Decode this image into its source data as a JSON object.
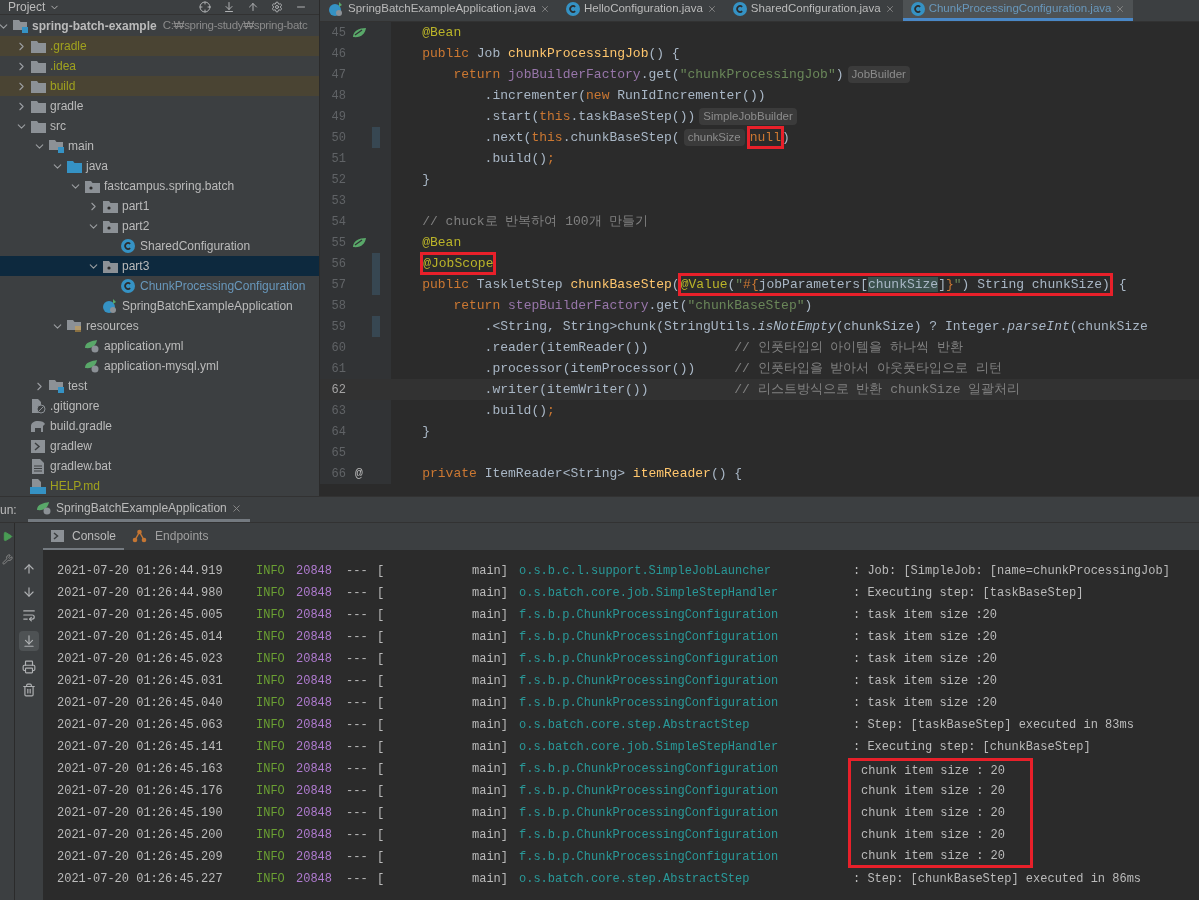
{
  "project_panel": {
    "title": "Project",
    "tree": [
      {
        "name": "spring-batch-example",
        "path": "C:₩spring-study₩spring-batc",
        "kind": "module",
        "expanded": true,
        "selected": false,
        "children": [
          {
            "name": ".gradle",
            "kind": "folder",
            "expanded": false,
            "selected": false,
            "excluded": true,
            "ignored": true
          },
          {
            "name": ".idea",
            "kind": "folder",
            "expanded": false,
            "selected": false,
            "excluded": false,
            "ignored": true
          },
          {
            "name": "build",
            "kind": "folder",
            "expanded": false,
            "selected": false,
            "excluded": true,
            "ignored": true
          },
          {
            "name": "gradle",
            "kind": "folder",
            "expanded": false,
            "selected": false
          },
          {
            "name": "src",
            "kind": "folder",
            "expanded": true,
            "selected": false,
            "children": [
              {
                "name": "main",
                "kind": "module",
                "expanded": true,
                "selected": false,
                "children": [
                  {
                    "name": "java",
                    "kind": "source",
                    "expanded": true,
                    "selected": false,
                    "children": [
                      {
                        "name": "fastcampus.spring.batch",
                        "kind": "package",
                        "expanded": true,
                        "selected": false,
                        "children": [
                          {
                            "name": "part1",
                            "kind": "package",
                            "expanded": false,
                            "selected": false
                          },
                          {
                            "name": "part2",
                            "kind": "package",
                            "expanded": true,
                            "selected": false,
                            "children": [
                              {
                                "name": "SharedConfiguration",
                                "kind": "class",
                                "selected": false
                              }
                            ]
                          },
                          {
                            "name": "part3",
                            "kind": "package",
                            "expanded": true,
                            "selected": true,
                            "children": [
                              {
                                "name": "ChunkProcessingConfiguration",
                                "kind": "class",
                                "selected": false,
                                "modified": true
                              }
                            ]
                          },
                          {
                            "name": "SpringBatchExampleApplication",
                            "kind": "spring",
                            "selected": false
                          }
                        ]
                      }
                    ]
                  },
                  {
                    "name": "resources",
                    "kind": "resources",
                    "expanded": true,
                    "selected": false,
                    "children": [
                      {
                        "name": "application.yml",
                        "kind": "yml",
                        "selected": false
                      },
                      {
                        "name": "application-mysql.yml",
                        "kind": "yml",
                        "selected": false
                      }
                    ]
                  }
                ]
              },
              {
                "name": "test",
                "kind": "module",
                "expanded": false,
                "selected": false
              }
            ]
          },
          {
            "name": ".gitignore",
            "kind": "gitignore",
            "selected": false
          },
          {
            "name": "build.gradle",
            "kind": "gradle",
            "selected": false
          },
          {
            "name": "gradlew",
            "kind": "shell",
            "selected": false
          },
          {
            "name": "gradlew.bat",
            "kind": "text",
            "selected": false
          },
          {
            "name": "HELP.md",
            "kind": "md",
            "selected": false,
            "ignored": true
          }
        ]
      }
    ]
  },
  "editor": {
    "tabs": [
      {
        "label": "SpringBatchExampleApplication.java",
        "kind": "spring",
        "selected": false
      },
      {
        "label": "HelloConfiguration.java",
        "kind": "class",
        "selected": false
      },
      {
        "label": "SharedConfiguration.java",
        "kind": "class",
        "selected": false
      },
      {
        "label": "ChunkProcessingConfiguration.java",
        "kind": "class",
        "selected": true
      }
    ],
    "lines": [
      {
        "number": "45",
        "kind": "bean",
        "current": false,
        "segments": [
          {
            "text": "    @Bean",
            "kind": "annotation"
          }
        ]
      },
      {
        "number": "46",
        "kind": "code",
        "current": false,
        "segments": [
          {
            "text": "    public",
            "kind": "keyword"
          },
          {
            "text": " Job ",
            "kind": "plain"
          },
          {
            "text": "chunkProcessingJob",
            "kind": "method"
          },
          {
            "text": "() {",
            "kind": "plain"
          }
        ]
      },
      {
        "number": "47",
        "kind": "code",
        "current": false,
        "segments": [
          {
            "text": "        return ",
            "kind": "keyword"
          },
          {
            "text": "jobBuilderFactory",
            "kind": "field"
          },
          {
            "text": ".get(",
            "kind": "plain"
          },
          {
            "text": "\"chunkProcessingJob\"",
            "kind": "string"
          },
          {
            "text": ")",
            "kind": "plain"
          },
          {
            "text": "JobBuilder",
            "kind": "hint"
          }
        ]
      },
      {
        "number": "48",
        "kind": "code",
        "current": false,
        "segments": [
          {
            "text": "            .incrementer(",
            "kind": "plain"
          },
          {
            "text": "new",
            "kind": "keyword"
          },
          {
            "text": " RunIdIncrementer())",
            "kind": "plain"
          }
        ]
      },
      {
        "number": "49",
        "kind": "code",
        "current": false,
        "segments": [
          {
            "text": "            .start(",
            "kind": "plain"
          },
          {
            "text": "this",
            "kind": "keyword"
          },
          {
            "text": ".taskBaseStep())",
            "kind": "plain"
          },
          {
            "text": "SimpleJobBuilder",
            "kind": "hint"
          }
        ]
      },
      {
        "number": "50",
        "kind": "code",
        "current": false,
        "changed": true,
        "segments": [
          {
            "text": "            .next(",
            "kind": "plain"
          },
          {
            "text": "this",
            "kind": "keyword"
          },
          {
            "text": ".chunkBaseStep(",
            "kind": "plain"
          },
          {
            "text": "chunkSize",
            "kind": "hint"
          },
          {
            "kind": "box",
            "segments": [
              {
                "text": "null",
                "kind": "keyword"
              }
            ]
          },
          {
            "text": ")",
            "kind": "plain"
          }
        ]
      },
      {
        "number": "51",
        "kind": "code",
        "current": false,
        "segments": [
          {
            "text": "            .build()",
            "kind": "plain"
          },
          {
            "text": ";",
            "kind": "keyword"
          }
        ]
      },
      {
        "number": "52",
        "kind": "code",
        "current": false,
        "segments": [
          {
            "text": "    }",
            "kind": "plain"
          }
        ]
      },
      {
        "number": "53",
        "kind": "code",
        "current": false
      },
      {
        "number": "54",
        "kind": "code",
        "current": false,
        "segments": [
          {
            "text": "    // chuck로 반복하여 100개 만들기",
            "kind": "comment"
          }
        ]
      },
      {
        "number": "55",
        "kind": "bean",
        "current": false,
        "segments": [
          {
            "text": "    @Bean",
            "kind": "annotation"
          }
        ]
      },
      {
        "number": "56",
        "kind": "code",
        "current": false,
        "changed": true,
        "segments": [
          {
            "kind": "box",
            "segments": [
              {
                "text": "    @JobScope",
                "kind": "annotation"
              }
            ]
          }
        ]
      },
      {
        "number": "57",
        "kind": "code",
        "current": false,
        "changed": true,
        "segments": [
          {
            "text": "    public",
            "kind": "keyword"
          },
          {
            "text": " TaskletStep ",
            "kind": "plain"
          },
          {
            "text": "chunkBaseStep",
            "kind": "method"
          },
          {
            "text": "(",
            "kind": "plain"
          },
          {
            "kind": "box",
            "segments": [
              {
                "text": "@Value",
                "kind": "annotation"
              },
              {
                "text": "(",
                "kind": "plain"
              },
              {
                "text": "\"",
                "kind": "string"
              },
              {
                "text": "#{",
                "kind": "keyword"
              },
              {
                "text": "jobParameters[",
                "kind": "plain"
              },
              {
                "text": "chunkSize",
                "kind": "match"
              },
              {
                "text": "]",
                "kind": "plain"
              },
              {
                "text": "}",
                "kind": "keyword"
              },
              {
                "text": "\"",
                "kind": "string"
              },
              {
                "text": ") String chunkSize)",
                "kind": "plain"
              }
            ]
          },
          {
            "text": " {",
            "kind": "plain"
          }
        ]
      },
      {
        "number": "58",
        "kind": "code",
        "current": false,
        "segments": [
          {
            "text": "        return ",
            "kind": "keyword"
          },
          {
            "text": "stepBuilderFactory",
            "kind": "field"
          },
          {
            "text": ".get(",
            "kind": "plain"
          },
          {
            "text": "\"chunkBaseStep\"",
            "kind": "string"
          },
          {
            "text": ")",
            "kind": "plain"
          }
        ]
      },
      {
        "number": "59",
        "kind": "code",
        "current": false,
        "changed": true,
        "segments": [
          {
            "text": "            .<String, String>chunk(StringUtils.",
            "kind": "plain"
          },
          {
            "text": "isNotEmpty",
            "kind": "static"
          },
          {
            "text": "(chunkSize) ? Integer.",
            "kind": "plain"
          },
          {
            "text": "parseInt",
            "kind": "static"
          },
          {
            "text": "(chunkSize",
            "kind": "plain"
          }
        ]
      },
      {
        "number": "60",
        "kind": "code",
        "current": false,
        "segments": [
          {
            "text": "            .reader(itemReader())",
            "kind": "plain"
          },
          {
            "text": "           // 인풋타입의 아이템을 하나씩 반환",
            "kind": "comment"
          }
        ]
      },
      {
        "number": "61",
        "kind": "code",
        "current": false,
        "segments": [
          {
            "text": "            .processor(itemProcessor())",
            "kind": "plain"
          },
          {
            "text": "     // 인풋타입을 받아서 아웃풋타입으로 리턴",
            "kind": "comment"
          }
        ]
      },
      {
        "number": "62",
        "kind": "code",
        "current": true,
        "segments": [
          {
            "text": "            .writer(itemWriter())",
            "kind": "plain"
          },
          {
            "text": "           // 리스트방식으로 반환 chunkSize 일괄처리",
            "kind": "comment"
          }
        ]
      },
      {
        "number": "63",
        "kind": "code",
        "current": false,
        "segments": [
          {
            "text": "            .build()",
            "kind": "plain"
          },
          {
            "text": ";",
            "kind": "keyword"
          }
        ]
      },
      {
        "number": "64",
        "kind": "code",
        "current": false,
        "segments": [
          {
            "text": "    }",
            "kind": "plain"
          }
        ]
      },
      {
        "number": "65",
        "kind": "code",
        "current": false
      },
      {
        "number": "66",
        "kind": "code",
        "current": false,
        "gutter_text": "@",
        "segments": [
          {
            "text": "    private",
            "kind": "keyword"
          },
          {
            "text": " ItemReader<String> ",
            "kind": "plain"
          },
          {
            "text": "itemReader",
            "kind": "method"
          },
          {
            "text": "() {",
            "kind": "plain"
          }
        ]
      }
    ]
  },
  "run_panel": {
    "label": "un:",
    "tab": "SpringBatchExampleApplication",
    "subtabs": [
      {
        "label": "Console",
        "kind": "console",
        "selected": true
      },
      {
        "label": "Endpoints",
        "kind": "endpoints",
        "selected": false
      }
    ],
    "log": [
      {
        "time": "2021-07-20 01:26:44.919",
        "level": "INFO",
        "pid": "20848",
        "sep": "---",
        "bracket": "[",
        "thread": "main]",
        "logger": "o.s.b.c.l.support.SimpleJobLauncher",
        "message": ": Job: [SimpleJob: [name=chunkProcessingJob]",
        "boxed": false
      },
      {
        "time": "2021-07-20 01:26:44.980",
        "level": "INFO",
        "pid": "20848",
        "sep": "---",
        "bracket": "[",
        "thread": "main]",
        "logger": "o.s.batch.core.job.SimpleStepHandler",
        "message": ": Executing step: [taskBaseStep]",
        "boxed": false
      },
      {
        "time": "2021-07-20 01:26:45.005",
        "level": "INFO",
        "pid": "20848",
        "sep": "---",
        "bracket": "[",
        "thread": "main]",
        "logger": "f.s.b.p.ChunkProcessingConfiguration",
        "message": ": task item size :20",
        "boxed": false
      },
      {
        "time": "2021-07-20 01:26:45.014",
        "level": "INFO",
        "pid": "20848",
        "sep": "---",
        "bracket": "[",
        "thread": "main]",
        "logger": "f.s.b.p.ChunkProcessingConfiguration",
        "message": ": task item size :20",
        "boxed": false
      },
      {
        "time": "2021-07-20 01:26:45.023",
        "level": "INFO",
        "pid": "20848",
        "sep": "---",
        "bracket": "[",
        "thread": "main]",
        "logger": "f.s.b.p.ChunkProcessingConfiguration",
        "message": ": task item size :20",
        "boxed": false
      },
      {
        "time": "2021-07-20 01:26:45.031",
        "level": "INFO",
        "pid": "20848",
        "sep": "---",
        "bracket": "[",
        "thread": "main]",
        "logger": "f.s.b.p.ChunkProcessingConfiguration",
        "message": ": task item size :20",
        "boxed": false
      },
      {
        "time": "2021-07-20 01:26:45.040",
        "level": "INFO",
        "pid": "20848",
        "sep": "---",
        "bracket": "[",
        "thread": "main]",
        "logger": "f.s.b.p.ChunkProcessingConfiguration",
        "message": ": task item size :20",
        "boxed": false
      },
      {
        "time": "2021-07-20 01:26:45.063",
        "level": "INFO",
        "pid": "20848",
        "sep": "---",
        "bracket": "[",
        "thread": "main]",
        "logger": "o.s.batch.core.step.AbstractStep",
        "message": ": Step: [taskBaseStep] executed in 83ms",
        "boxed": false
      },
      {
        "time": "2021-07-20 01:26:45.141",
        "level": "INFO",
        "pid": "20848",
        "sep": "---",
        "bracket": "[",
        "thread": "main]",
        "logger": "o.s.batch.core.job.SimpleStepHandler",
        "message": ": Executing step: [chunkBaseStep]",
        "boxed": false
      },
      {
        "time": "2021-07-20 01:26:45.163",
        "level": "INFO",
        "pid": "20848",
        "sep": "---",
        "bracket": "[",
        "thread": "main]",
        "logger": "f.s.b.p.ChunkProcessingConfiguration",
        "message": "chunk item size : 20",
        "boxed": true
      },
      {
        "time": "2021-07-20 01:26:45.176",
        "level": "INFO",
        "pid": "20848",
        "sep": "---",
        "bracket": "[",
        "thread": "main]",
        "logger": "f.s.b.p.ChunkProcessingConfiguration",
        "message": "chunk item size : 20",
        "boxed": true
      },
      {
        "time": "2021-07-20 01:26:45.190",
        "level": "INFO",
        "pid": "20848",
        "sep": "---",
        "bracket": "[",
        "thread": "main]",
        "logger": "f.s.b.p.ChunkProcessingConfiguration",
        "message": "chunk item size : 20",
        "boxed": true
      },
      {
        "time": "2021-07-20 01:26:45.200",
        "level": "INFO",
        "pid": "20848",
        "sep": "---",
        "bracket": "[",
        "thread": "main]",
        "logger": "f.s.b.p.ChunkProcessingConfiguration",
        "message": "chunk item size : 20",
        "boxed": true
      },
      {
        "time": "2021-07-20 01:26:45.209",
        "level": "INFO",
        "pid": "20848",
        "sep": "---",
        "bracket": "[",
        "thread": "main]",
        "logger": "f.s.b.p.ChunkProcessingConfiguration",
        "message": "chunk item size : 20",
        "boxed": true
      },
      {
        "time": "2021-07-20 01:26:45.227",
        "level": "INFO",
        "pid": "20848",
        "sep": "---",
        "bracket": "[",
        "thread": "main]",
        "logger": "o.s.batch.core.step.AbstractStep",
        "message": ": Step: [chunkBaseStep] executed in 86ms",
        "boxed": false
      }
    ]
  }
}
